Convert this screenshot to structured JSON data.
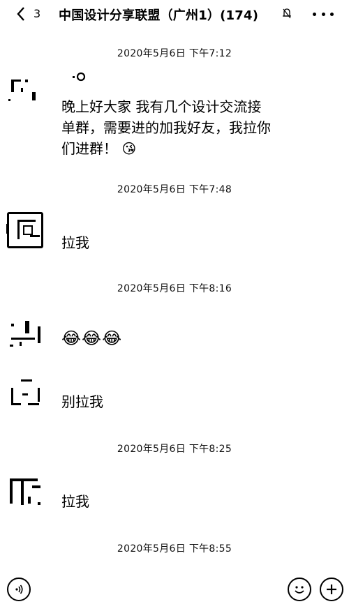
{
  "header": {
    "back_icon": "chevron-left-icon",
    "unread_count": "3",
    "title": "中国设计分享联盟（广州1）(174)",
    "mute_icon": "bell-off-icon",
    "more_icon": "more-horizontal-icon"
  },
  "messages": [
    {
      "timestamp": "2020年5月6日 下午7:12",
      "avatar_icon": "avatar",
      "lines": [
        "晚上好大家 我有几个设计交流接",
        "单群，需要进的加我好友，我拉你",
        "们进群！"
      ],
      "trailing_emoji": "😘"
    },
    {
      "timestamp": "2020年5月6日 下午7:48",
      "avatar_icon": "avatar",
      "text": "拉我"
    },
    {
      "timestamp": "2020年5月6日 下午8:16",
      "avatar_icon": "avatar",
      "emoji": "😂😂😂"
    },
    {
      "avatar_icon": "avatar",
      "text": "别拉我"
    },
    {
      "timestamp": "2020年5月6日 下午8:25",
      "avatar_icon": "avatar",
      "text": "拉我"
    },
    {
      "timestamp": "2020年5月6日 下午8:55"
    }
  ],
  "inputbar": {
    "voice_icon": "voice-icon",
    "emoji_icon": "smiley-icon",
    "plus_icon": "plus-icon"
  }
}
